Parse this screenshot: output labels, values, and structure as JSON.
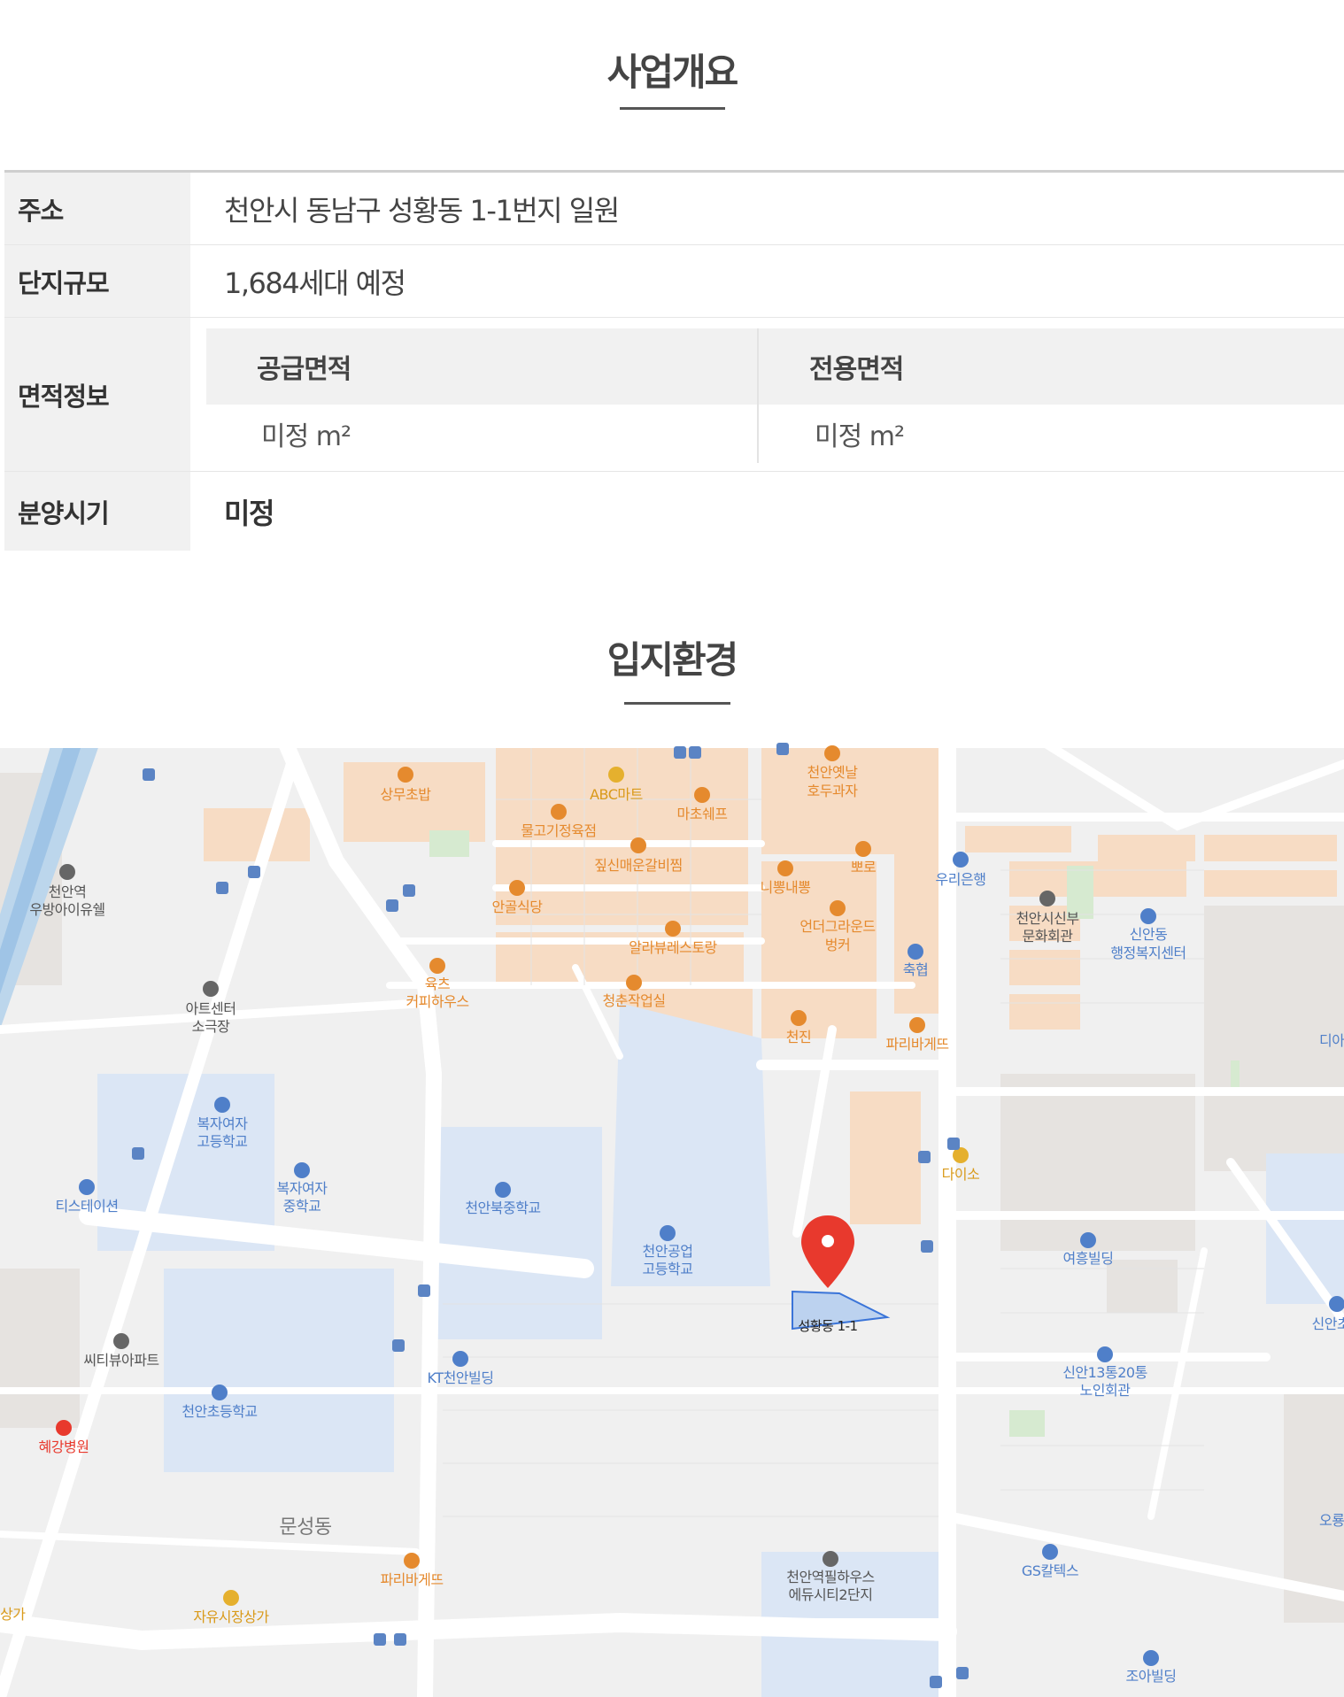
{
  "overview": {
    "title": "사업개요",
    "rows": {
      "address": {
        "label": "주소",
        "value": "천안시 동남구 성황동 1-1번지 일원"
      },
      "scale": {
        "label": "단지규모",
        "value": "1,684세대 예정"
      },
      "area": {
        "label": "면적정보",
        "supply_label": "공급면적",
        "exclusive_label": "전용면적",
        "supply_value": "미정 m²",
        "exclusive_value": "미정 m²"
      },
      "sale": {
        "label": "분양시기",
        "value": "미정"
      }
    }
  },
  "location": {
    "title": "입지환경",
    "map": {
      "marker_label": "성황동 1-1",
      "pois": {
        "p1": "상무초밥",
        "p2": "ABC마트",
        "p3": "천안옛날",
        "p3b": "호두과자",
        "p4": "물고기정육점",
        "p5": "마초쉐프",
        "p6": "짚신매운갈비찜",
        "p7": "뽀로",
        "p8": "니뽕내뽕",
        "p9": "우리은행",
        "p10": "천안역",
        "p10b": "우방아이유쉘",
        "p11": "안골식당",
        "p12": "언더그라운드",
        "p12b": "벙커",
        "p13": "천안시신부",
        "p13b": "문화회관",
        "p14": "신안동",
        "p14b": "행정복지센터",
        "p15": "알라뷰레스토랑",
        "p16": "축협",
        "p17": "육츠",
        "p17b": "커피하우스",
        "p18": "청춘작업실",
        "p19": "아트센터",
        "p19b": "소극장",
        "p20": "천진",
        "p21": "파리바게뜨",
        "p22": "디아",
        "p23": "복자여자",
        "p23b": "고등학교",
        "p24": "다이소",
        "p25": "복자여자",
        "p25b": "중학교",
        "p26": "티스테이션",
        "p27": "천안북중학교",
        "p28": "천안공업",
        "p28b": "고등학교",
        "p29": "여흥빌딩",
        "p30": "신안초등",
        "p31": "씨티뷰아파트",
        "p32": "KT천안빌딩",
        "p33": "신안13통20통",
        "p33b": "노인회관",
        "p34": "천안초등학교",
        "p35": "혜강병원",
        "p36": "문성동",
        "p37": "오룡",
        "p38": "GS칼텍스",
        "p39": "파리바게뜨",
        "p40": "천안역필하우스",
        "p40b": "에듀시티2단지",
        "p41": "자유시장상가",
        "p42": "상가",
        "p43": "조아빌딩"
      }
    }
  },
  "colors": {
    "poi_orange": "#e58a2e",
    "poi_blue": "#4f7fc9",
    "poi_gray": "#666666",
    "marker_red": "#e8392d",
    "school_blue": "#dbe6f5"
  }
}
